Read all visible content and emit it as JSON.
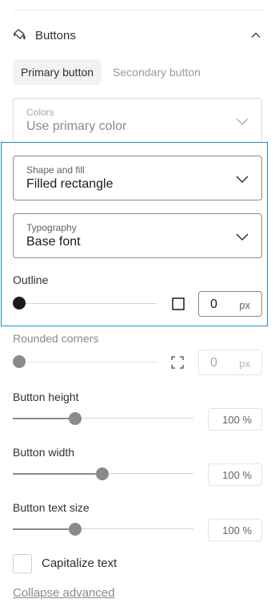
{
  "section": {
    "title": "Buttons",
    "icon": "paint-bucket-icon",
    "expanded": true
  },
  "tabs": [
    {
      "label": "Primary button",
      "active": true
    },
    {
      "label": "Secondary button",
      "active": false
    }
  ],
  "colors": {
    "label": "Colors",
    "value": "Use primary color"
  },
  "shape": {
    "label": "Shape and fill",
    "value": "Filled rectangle"
  },
  "typography": {
    "label": "Typography",
    "value": "Base font"
  },
  "outline": {
    "label": "Outline",
    "value": "0",
    "unit": "px",
    "level": 0
  },
  "rounded": {
    "label": "Rounded corners",
    "value": "0",
    "unit": "px",
    "level": 0
  },
  "height": {
    "label": "Button height",
    "value": "100 %",
    "level": 0.35
  },
  "width": {
    "label": "Button width",
    "value": "100 %",
    "level": 0.5
  },
  "text_size": {
    "label": "Button text size",
    "value": "100 %",
    "level": 0.35
  },
  "capitalize": {
    "label": "Capitalize text",
    "checked": false
  },
  "collapse_link": "Collapse advanced",
  "colors_theme": {
    "accent_focus": "#1f8bd0",
    "text": "#303030",
    "muted": "#8a8a8a"
  }
}
